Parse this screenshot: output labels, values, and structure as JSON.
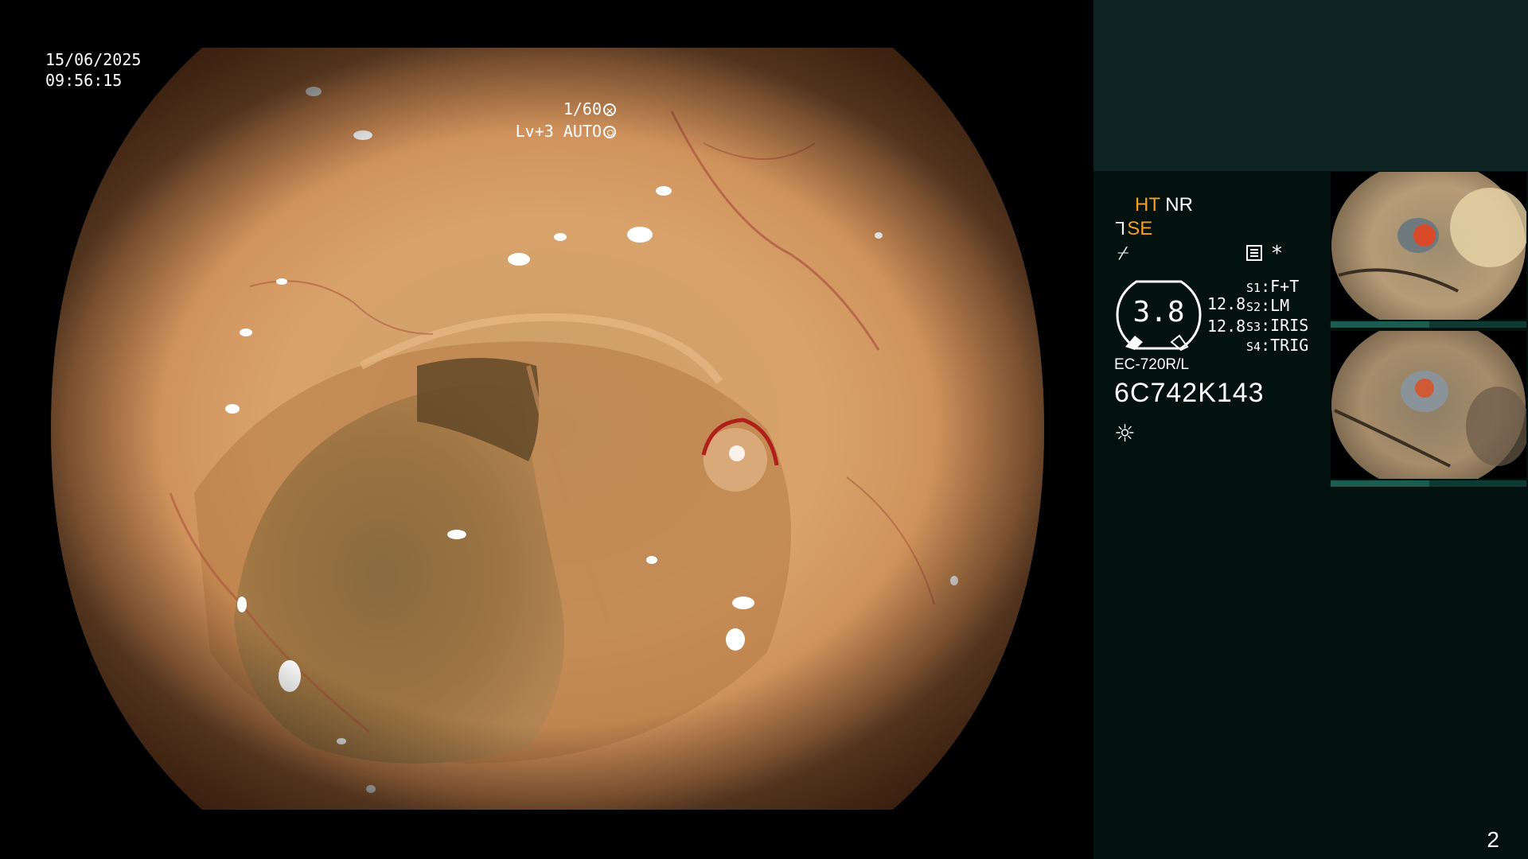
{
  "overlay": {
    "date": "15/06/2025",
    "time": "09:56:15",
    "shutter": "1/60",
    "iris": "Lv+3 AUTO"
  },
  "panel": {
    "ht": "HT",
    "nr": "NR",
    "se": "SE",
    "gauge_value": "3.8",
    "value_a": "12.8",
    "value_b": "12.8",
    "switches": [
      {
        "key": "S1",
        "value": "F+T"
      },
      {
        "key": "S2",
        "value": "LM"
      },
      {
        "key": "S3",
        "value": "IRIS"
      },
      {
        "key": "S4",
        "value": "TRIG"
      }
    ],
    "model": "EC-720R/L",
    "serial": "6C742K143",
    "page_number": "2"
  },
  "icons": {
    "shutter": "shutter-icon",
    "iris": "iris-icon",
    "scope_tip": "scope-tip-icon",
    "flash": "flash-off-icon",
    "record": "record-icon",
    "asterisk": "asterisk-icon",
    "light": "light-source-icon"
  },
  "colors": {
    "accent": "#f4a020",
    "panel": "#03120f",
    "panel_band": "#0d2422"
  }
}
